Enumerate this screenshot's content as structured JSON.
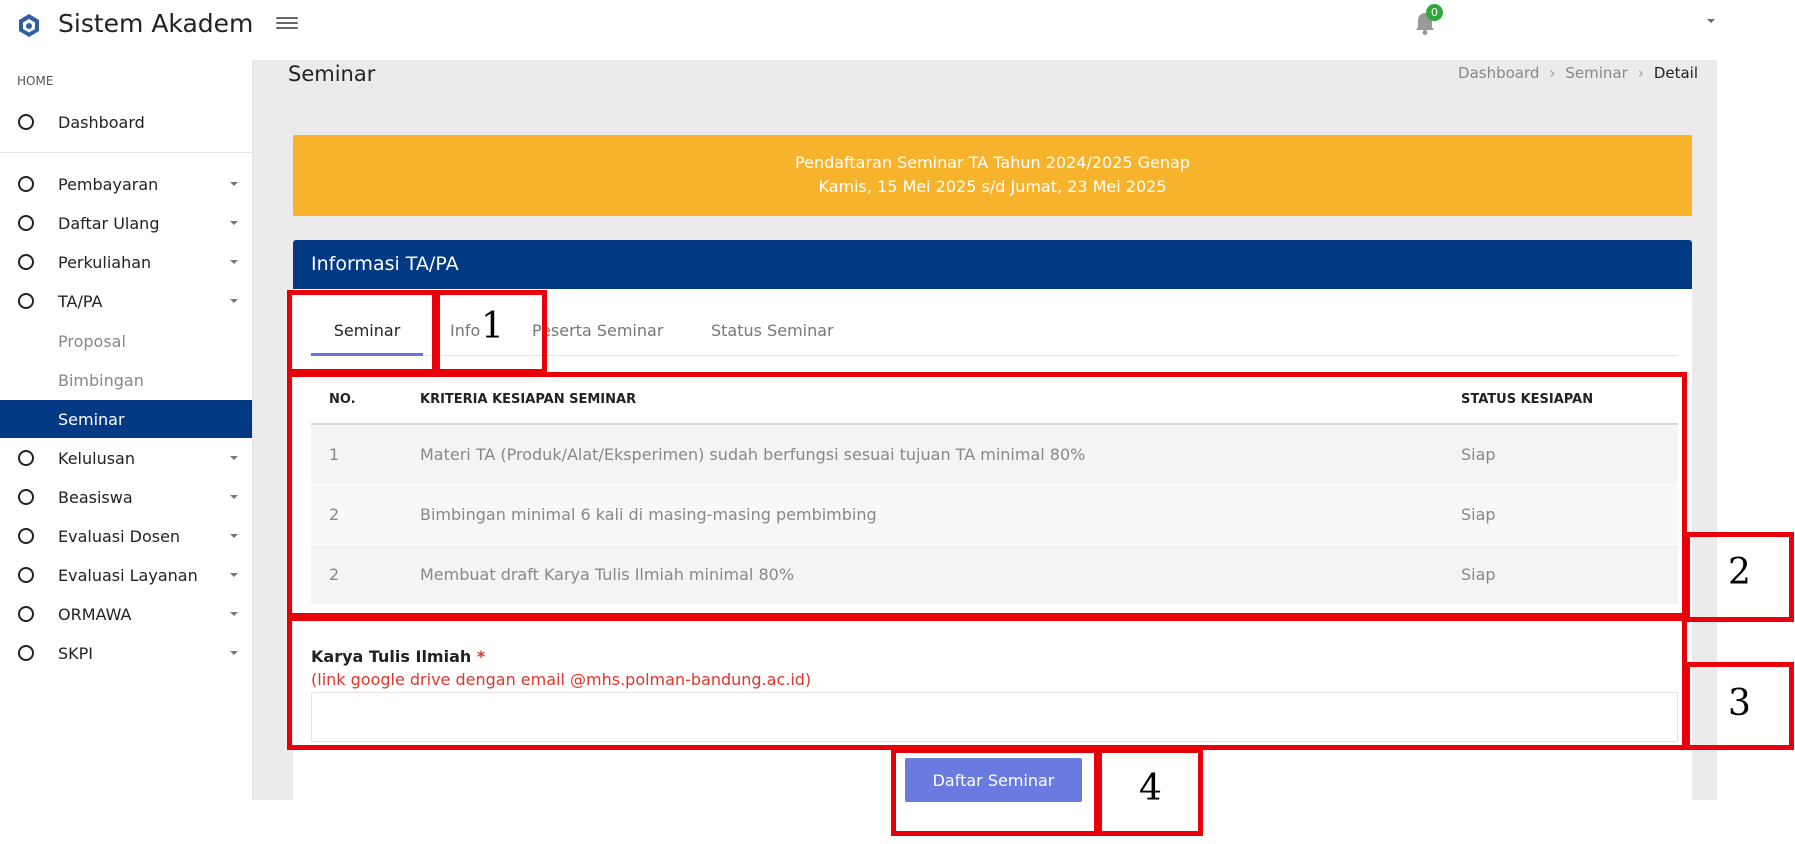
{
  "app": {
    "title": "Sistem Akademik",
    "notification_count": "0"
  },
  "sidebar": {
    "section_label": "HOME",
    "dashboard": "Dashboard",
    "items": [
      {
        "label": "Pembayaran"
      },
      {
        "label": "Daftar Ulang"
      },
      {
        "label": "Perkuliahan"
      },
      {
        "label": "TA/PA"
      },
      {
        "label": "Kelulusan"
      },
      {
        "label": "Beasiswa"
      },
      {
        "label": "Evaluasi Dosen"
      },
      {
        "label": "Evaluasi Layanan"
      },
      {
        "label": "ORMAWA"
      },
      {
        "label": "SKPI"
      }
    ],
    "sub_items": [
      {
        "label": "Proposal"
      },
      {
        "label": "Bimbingan"
      },
      {
        "label": "Seminar"
      }
    ]
  },
  "page": {
    "title": "Seminar",
    "breadcrumb": [
      "Dashboard",
      "Seminar",
      "Detail"
    ]
  },
  "banner": {
    "line1": "Pendaftaran Seminar TA Tahun 2024/2025 Genap",
    "line2": "Kamis, 15 Mei 2025 s/d Jumat, 23 Mei 2025"
  },
  "card": {
    "title": "Informasi TA/PA",
    "tabs": [
      "Seminar",
      "Info",
      "Peserta Seminar",
      "Status Seminar"
    ]
  },
  "table": {
    "headers": [
      "NO.",
      "KRITERIA KESIAPAN SEMINAR",
      "STATUS KESIAPAN"
    ],
    "rows": [
      {
        "no": "1",
        "kriteria": "Materi TA (Produk/Alat/Eksperimen) sudah berfungsi sesuai tujuan TA minimal 80%",
        "status": "Siap"
      },
      {
        "no": "2",
        "kriteria": "Bimbingan minimal 6 kali di masing-masing pembimbing",
        "status": "Siap"
      },
      {
        "no": "2",
        "kriteria": "Membuat draft Karya Tulis Ilmiah minimal 80%",
        "status": "Siap"
      }
    ]
  },
  "form": {
    "label": "Karya Tulis Ilmiah",
    "required_mark": "*",
    "hint": "(link google drive dengan email @mhs.polman-bandung.ac.id)",
    "value": "",
    "submit_label": "Daftar Seminar"
  },
  "annotations": [
    "1",
    "2",
    "3",
    "4"
  ]
}
